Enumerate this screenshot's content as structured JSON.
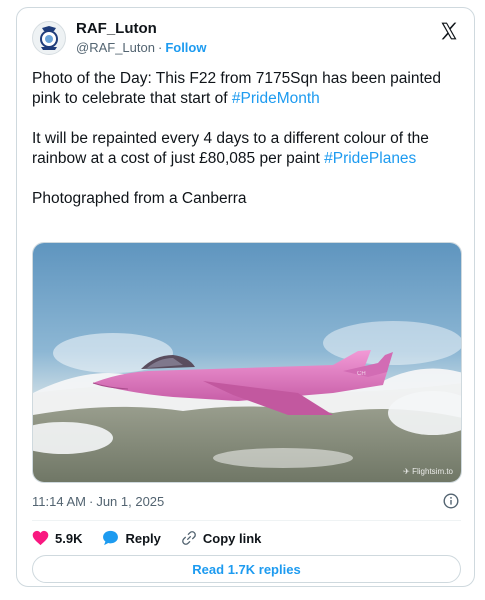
{
  "author": {
    "name": "RAF_Luton",
    "handle": "@RAF_Luton",
    "separator": "·",
    "follow_label": "Follow"
  },
  "tweet": {
    "para1_text": "Photo of the Day: This F22 from 7175Sqn has been painted pink to celebrate that start of ",
    "para1_hashtag": "#PrideMonth",
    "para2_text": "It will be repainted every 4 days to a different colour of the rainbow at a cost of just £80,085 per paint ",
    "para2_hashtag": "#PridePlanes",
    "para3_text": "Photographed from a Canberra"
  },
  "photo": {
    "watermark": "✈ Flightsim.to",
    "colors": {
      "sky": "#6a9ec4",
      "aircraft": "#e27ac2",
      "cloud": "#f4f6f7"
    }
  },
  "meta": {
    "time": "11:14 AM",
    "separator": "·",
    "date": "Jun 1, 2025"
  },
  "actions": {
    "likes_count": "5.9K",
    "reply_label": "Reply",
    "copy_link_label": "Copy link"
  },
  "read_replies_label": "Read 1.7K replies",
  "colors": {
    "accent": "#1d9bf0",
    "like": "#f91880",
    "muted": "#536471"
  }
}
